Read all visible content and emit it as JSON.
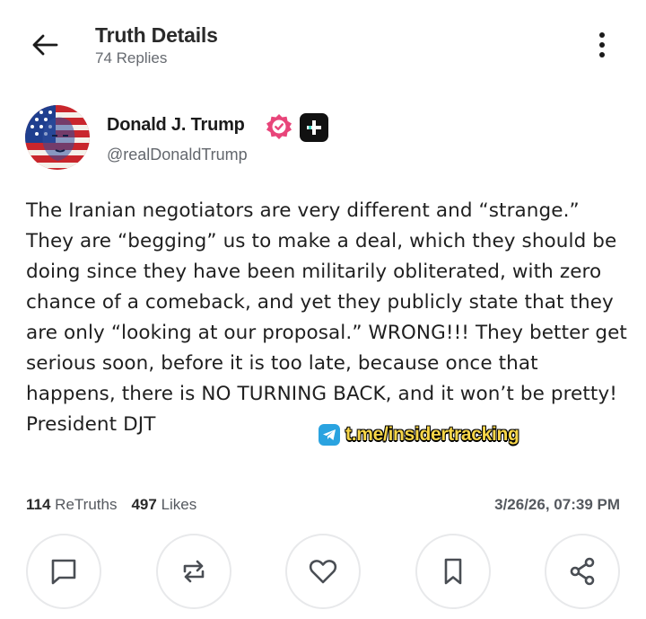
{
  "header": {
    "title": "Truth Details",
    "replies": "74 Replies"
  },
  "author": {
    "name": "Donald J. Trump",
    "handle": "@realDonaldTrump"
  },
  "post": {
    "text": "The Iranian negotiators are very different and “strange.” They are “begging” us to make a deal, which they should be doing since they have been militarily obliterated, with zero chance of a comeback, and yet they publicly state that they are only “looking at our proposal.” WRONG!!! They better get serious soon, before it is too late, because once that happens, there is NO TURNING BACK, and it won’t be pretty! President DJT"
  },
  "watermark": {
    "text": "t.me/insidertracking",
    "icon": "telegram-icon"
  },
  "stats": {
    "retruths_count": "114",
    "retruths_label": "ReTruths",
    "likes_count": "497",
    "likes_label": "Likes",
    "timestamp": "3/26/26, 07:39 PM"
  },
  "actions": [
    {
      "name": "reply",
      "icon": "comment-icon"
    },
    {
      "name": "retruth",
      "icon": "repost-icon"
    },
    {
      "name": "like",
      "icon": "heart-icon"
    },
    {
      "name": "bookmark",
      "icon": "bookmark-icon"
    },
    {
      "name": "share",
      "icon": "share-icon"
    }
  ],
  "colors": {
    "verified_badge": "#e8457a",
    "watermark_text": "#f7d649",
    "telegram": "#2aa3e0"
  }
}
